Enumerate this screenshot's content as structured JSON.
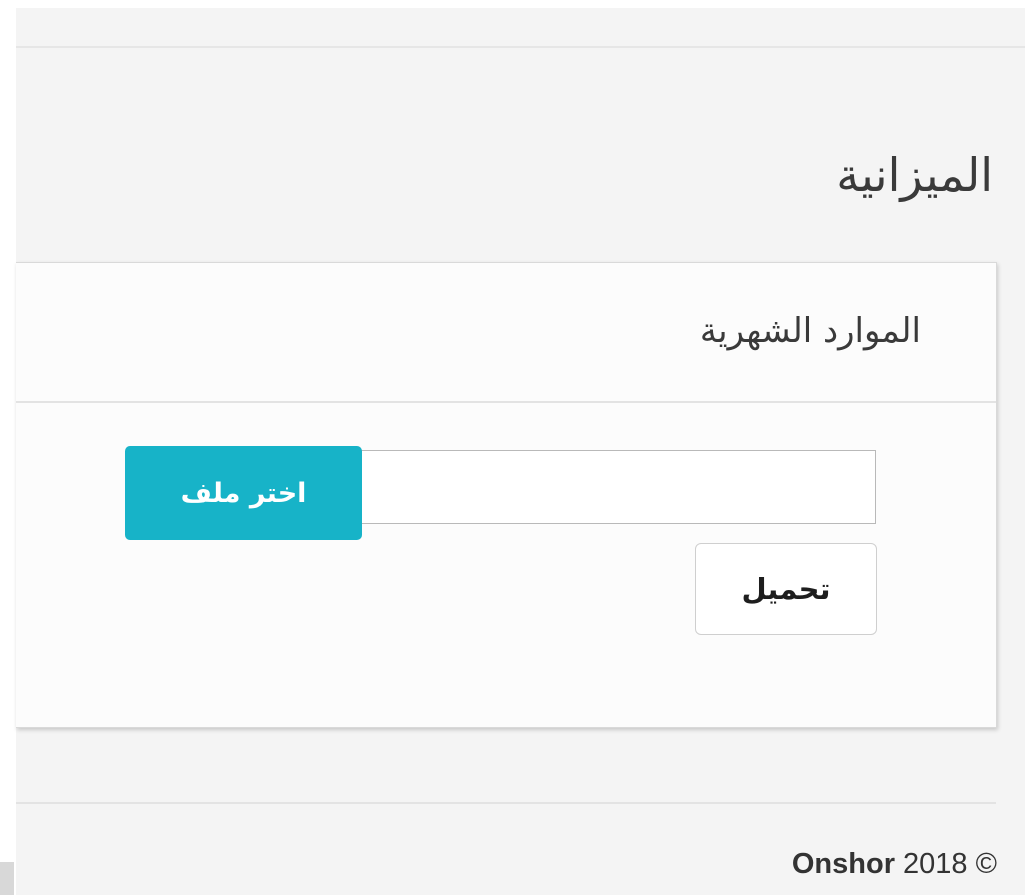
{
  "page": {
    "title": "الميزانية"
  },
  "panel": {
    "title": "الموارد الشهرية",
    "file_input_value": "",
    "choose_file_label": "اختر ملف",
    "upload_label": "تحميل"
  },
  "footer": {
    "brand": "Onshor",
    "year": "2018",
    "copyright_symbol": "©"
  },
  "colors": {
    "accent": "#17b3c8",
    "background": "#f4f4f4",
    "panel": "#fcfcfc"
  }
}
